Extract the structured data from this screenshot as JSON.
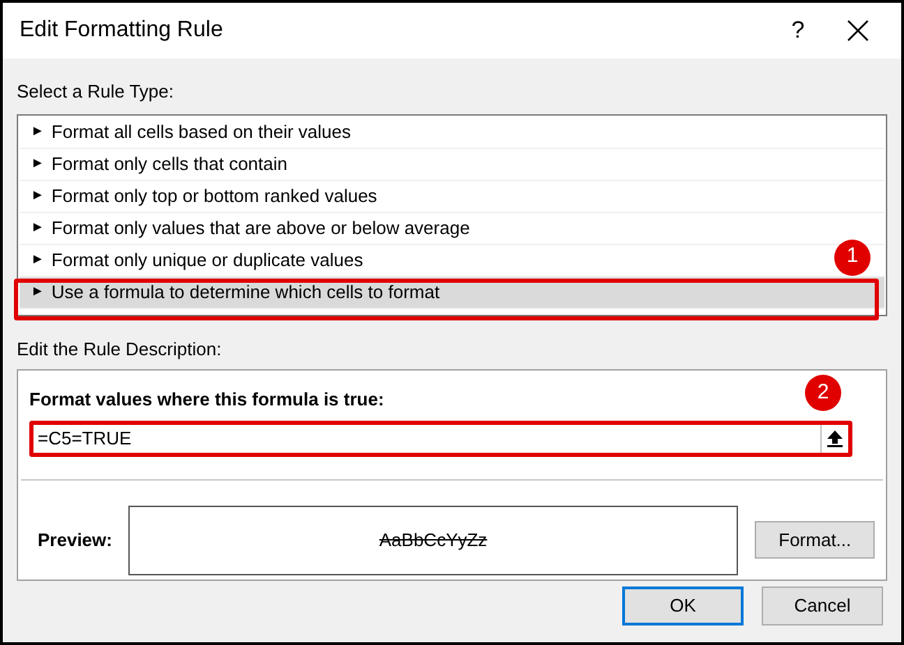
{
  "window": {
    "title": "Edit Formatting Rule",
    "help": "?"
  },
  "rule_type": {
    "label": "Select a Rule Type:",
    "items": [
      {
        "marker": "►",
        "label": "Format all cells based on their values",
        "selected": false
      },
      {
        "marker": "►",
        "label": "Format only cells that contain",
        "selected": false
      },
      {
        "marker": "►",
        "label": "Format only top or bottom ranked values",
        "selected": false
      },
      {
        "marker": "►",
        "label": "Format only values that are above or below average",
        "selected": false
      },
      {
        "marker": "►",
        "label": "Format only unique or duplicate values",
        "selected": false
      },
      {
        "marker": "►",
        "label": "Use a formula to determine which cells to format",
        "selected": true
      }
    ]
  },
  "description": {
    "label": "Edit the Rule Description:",
    "formula_label": "Format values where this formula is true:",
    "formula_value": "=C5=TRUE",
    "preview_label": "Preview:",
    "preview_sample": "AaBbCcYyZz",
    "format_button": "Format..."
  },
  "callouts": [
    "1",
    "2"
  ],
  "buttons": [
    {
      "label": "OK",
      "default": true
    },
    {
      "label": "Cancel",
      "default": false
    }
  ]
}
